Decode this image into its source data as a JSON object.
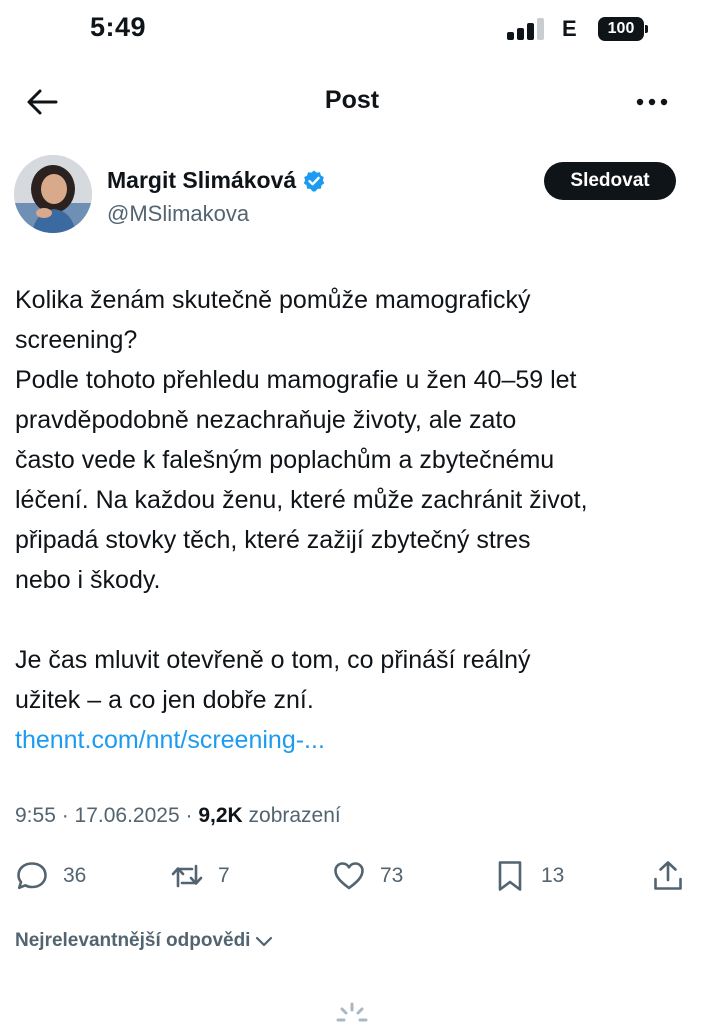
{
  "status_bar": {
    "time": "5:49",
    "network": "E",
    "battery": "100"
  },
  "header": {
    "title": "Post",
    "back_icon": "arrow-left-icon",
    "more_icon": "more-horizontal-icon"
  },
  "author": {
    "display_name": "Margit Slimáková",
    "handle": "@MSlimakova",
    "verified": true,
    "follow_label": "Sledovat"
  },
  "post": {
    "lines": [
      "Kolika ženám skutečně pomůže mamografický",
      "screening?",
      "Podle tohoto přehledu mamografie u žen 40–59 let",
      "pravděpodobně nezachraňuje životy, ale zato",
      "často vede k falešným poplachům a zbytečnému",
      "léčení. Na každou ženu, které může zachránit život,",
      "připadá stovky těch, které zažijí zbytečný stres",
      "nebo i škody."
    ],
    "lines2": [
      "Je čas mluvit otevřeně o tom, co přináší reálný",
      "užitek – a co jen dobře zní."
    ],
    "link": "thennt.com/nnt/screening-..."
  },
  "meta": {
    "time": "9:55",
    "date": "17.06.2025",
    "views": "9,2K",
    "views_label": "zobrazení"
  },
  "actions": {
    "replies": "36",
    "reposts": "7",
    "likes": "73",
    "bookmarks": "13"
  },
  "replies_sort": {
    "label": "Nejrelevantnější odpovědi"
  },
  "colors": {
    "accent": "#1d9bf0",
    "text": "#0f1419",
    "secondary": "#536471"
  }
}
